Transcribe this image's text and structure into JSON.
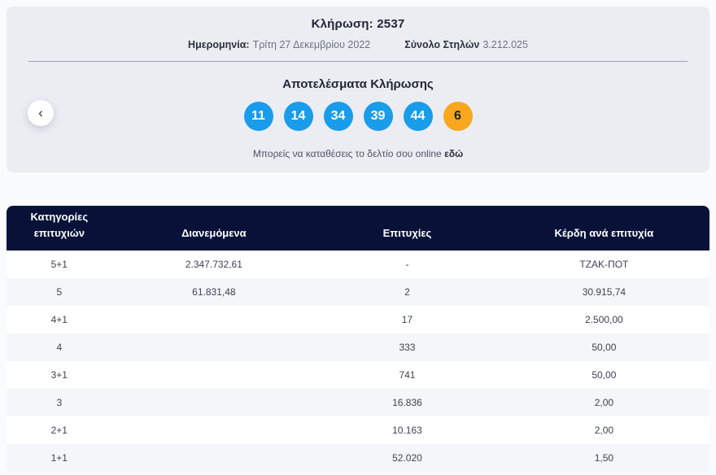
{
  "draw": {
    "title_label": "Κλήρωση:",
    "title_number": "2537",
    "date_label": "Ημερομηνία:",
    "date_value": "Τρίτη 27 Δεκεμβρίου 2022",
    "columns_label": "Σύνολο Στηλών",
    "columns_value": "3.212.025",
    "results_title": "Αποτελέσματα Κλήρωσης",
    "numbers": [
      "11",
      "14",
      "34",
      "39",
      "44"
    ],
    "joker_number": "6",
    "note_text": "Μπορείς να καταθέσεις το δελτίο σου online",
    "note_link_label": "εδώ",
    "prev_chevron": "‹"
  },
  "colors": {
    "ball_blue": "#199ce9",
    "ball_joker_orange": "#f9a71c",
    "table_header_navy": "#081239",
    "card_background": "#ebedf3"
  },
  "table": {
    "header_category_line1": "Κατηγορίες",
    "header_category_line2": "επιτυχιών",
    "header_distributed": "Διανεμόμενα",
    "header_winners": "Επιτυχίες",
    "header_prize": "Κέρδη ανά επιτυχία",
    "rows": [
      {
        "category": "5+1",
        "distributed": "2.347.732,61",
        "winners": "-",
        "prize": "ΤΖΑΚ-ΠΟΤ"
      },
      {
        "category": "5",
        "distributed": "61.831,48",
        "winners": "2",
        "prize": "30.915,74"
      },
      {
        "category": "4+1",
        "distributed": "",
        "winners": "17",
        "prize": "2.500,00"
      },
      {
        "category": "4",
        "distributed": "",
        "winners": "333",
        "prize": "50,00"
      },
      {
        "category": "3+1",
        "distributed": "",
        "winners": "741",
        "prize": "50,00"
      },
      {
        "category": "3",
        "distributed": "",
        "winners": "16.836",
        "prize": "2,00"
      },
      {
        "category": "2+1",
        "distributed": "",
        "winners": "10.163",
        "prize": "2,00"
      },
      {
        "category": "1+1",
        "distributed": "",
        "winners": "52.020",
        "prize": "1,50"
      }
    ]
  }
}
